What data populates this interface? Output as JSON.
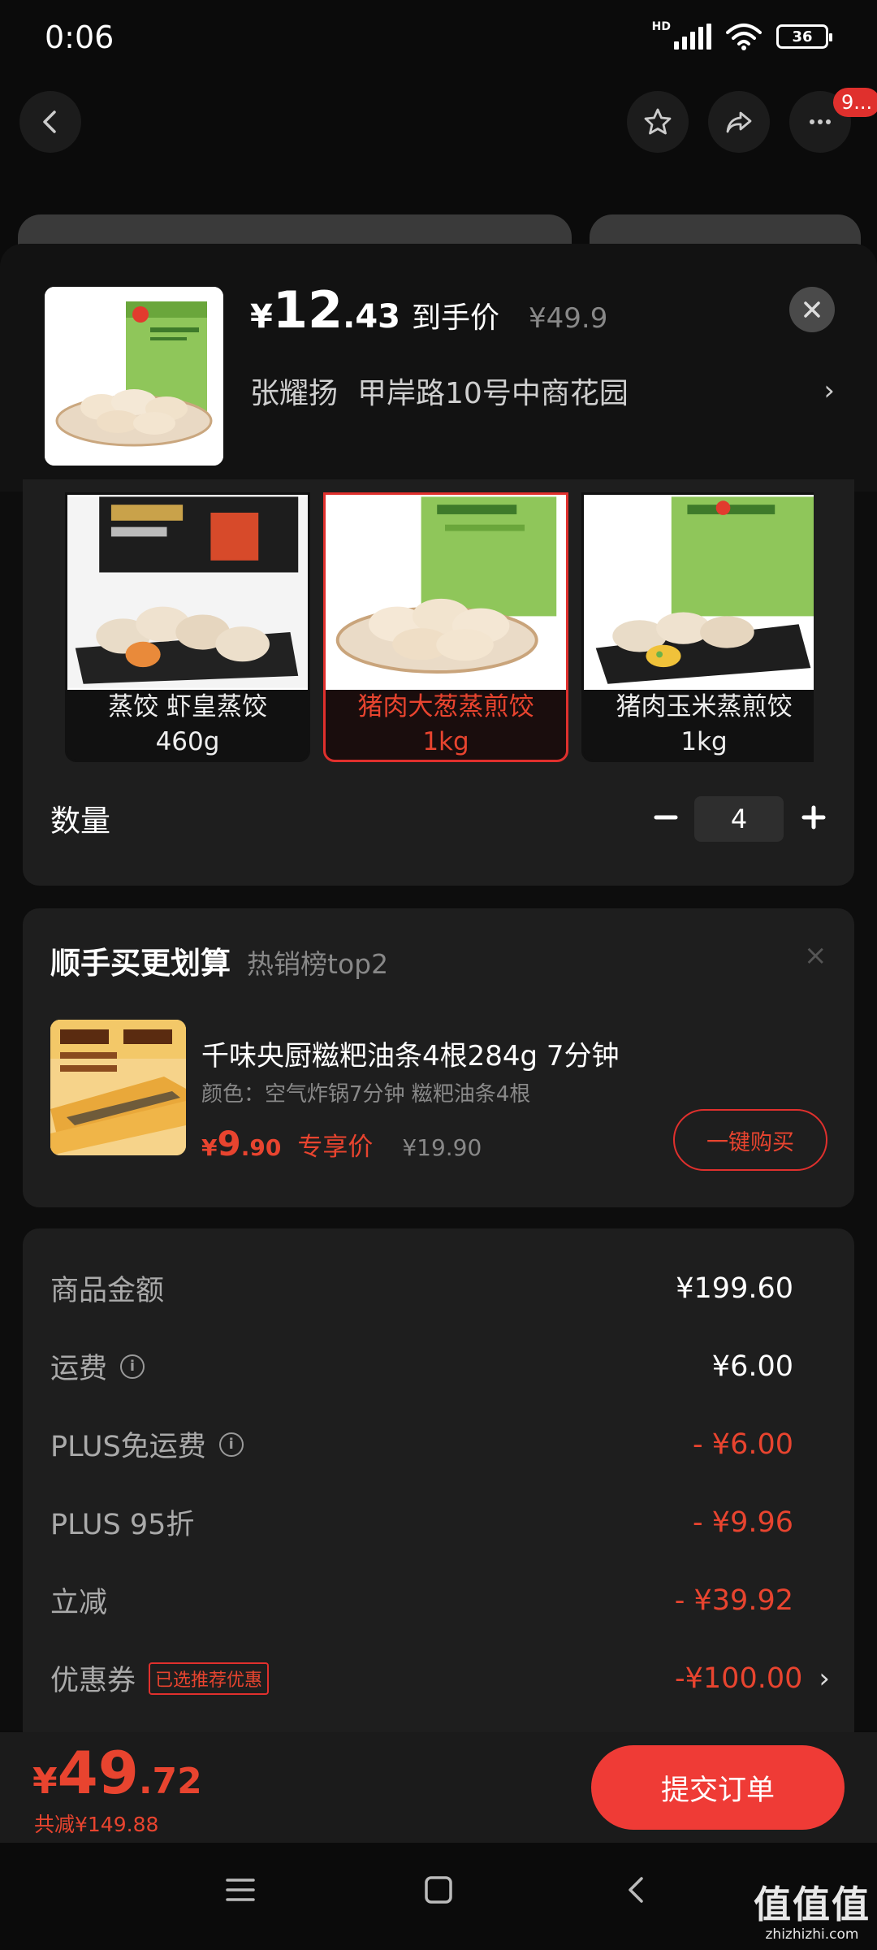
{
  "status_bar": {
    "time": "0:06",
    "network": "HD",
    "battery": "36"
  },
  "nav": {
    "messages_badge": "9..."
  },
  "product": {
    "yen": "¥",
    "price_int": "12",
    "price_dec": ".43",
    "price_tag": "到手价",
    "original_price": "¥49.9"
  },
  "address": {
    "name": "张耀扬",
    "detail": "甲岸路10号中商花园",
    "chevron": "›"
  },
  "variants": [
    {
      "line1": "蒸饺 虾皇蒸饺",
      "line2": "460g",
      "selected": false
    },
    {
      "line1": "猪肉大葱蒸煎饺",
      "line2": "1kg",
      "selected": true
    },
    {
      "line1": "猪肉玉米蒸煎饺",
      "line2": "1kg",
      "selected": false
    }
  ],
  "quantity": {
    "label": "数量",
    "value": "4"
  },
  "upsell": {
    "title": "顺手买更划算",
    "subtitle": "热销榜top2",
    "close": "×",
    "name": "千味央厨糍粑油条4根284g 7分钟",
    "variant": "颜色：空气炸锅7分钟 糍粑油条4根",
    "price_yen": "¥",
    "price_int": "9",
    "price_dec": ".90",
    "price_tag": "专享价",
    "original_price": "¥19.90",
    "buy_label": "一键购买"
  },
  "summary": {
    "rows": [
      {
        "label": "商品金额",
        "value": "¥199.60"
      },
      {
        "label": "运费",
        "value": "¥6.00"
      },
      {
        "label": "PLUS免运费",
        "value": "- ¥6.00"
      },
      {
        "label": "PLUS 95折",
        "value": "- ¥9.96"
      },
      {
        "label": "立减",
        "value": "- ¥39.92"
      },
      {
        "label": "优惠券",
        "value": "-¥100.00"
      }
    ],
    "coupon_badge": "已选推荐优惠",
    "coupon_chevron": "›"
  },
  "total": {
    "yen": "¥",
    "price_int": "49",
    "price_dec": ".72",
    "saved": "共减¥149.88",
    "submit_label": "提交订单"
  },
  "watermark": {
    "big": "值值值",
    "small": "zhizhizhi.com"
  },
  "colors": {
    "accent": "#e8442f",
    "button": "#ef3b36",
    "card": "#1e1e1e"
  }
}
